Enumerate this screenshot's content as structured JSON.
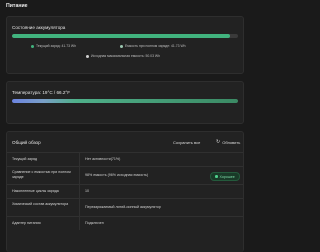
{
  "page": {
    "title": "Питание"
  },
  "battery": {
    "heading": "Состояние аккумулятора",
    "fill_percent": 96.5,
    "legend": [
      {
        "label": "Текущий заряд: 41.73 Wh",
        "color": "#41b37e"
      },
      {
        "label": "Емкость при полном заряде: 41.73 Wh",
        "color": "#9cc8b0"
      },
      {
        "label": "Исходная максимальная емкость: 50.03 Wh",
        "color": "#cfcfcf"
      }
    ]
  },
  "temperature": {
    "heading": "Температура: 19°C / 66.2°F",
    "fill_percent": 100
  },
  "overview": {
    "title": "Общий обзор",
    "save_label": "Сохранить все",
    "refresh_icon": "refresh-icon",
    "refresh_label": "Обновить",
    "rows": [
      {
        "label": "Текущий заряд",
        "value": "Нет активности(71%)"
      },
      {
        "label": "Сравнение с емкостью при полном заряде",
        "value": "98% емкость (96% исходная емкость)",
        "badge": "Хорошее"
      },
      {
        "label": "Накопленные циклы заряда",
        "value": "10"
      },
      {
        "label": "Химический состав аккумулятора",
        "value": "Перезаряжаемый литий-ионный аккумулятор"
      },
      {
        "label": "Адаптер питания",
        "value": "Подключен"
      }
    ]
  }
}
